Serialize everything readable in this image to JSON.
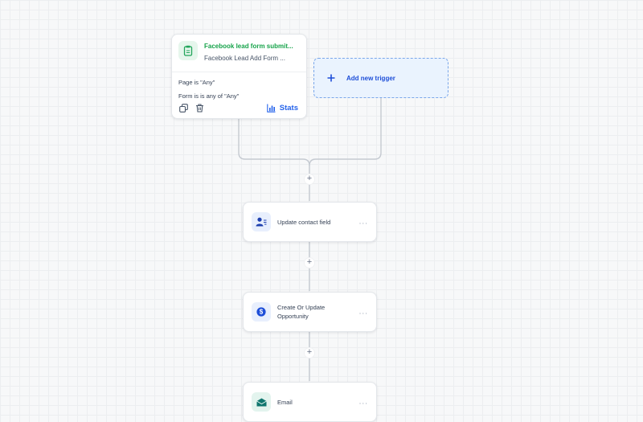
{
  "trigger": {
    "icon": "clipboard-icon",
    "title": "Facebook lead form submit...",
    "subtitle": "Facebook Lead Add Form ...",
    "filters": [
      "Page is \"Any\"",
      "Form is is any of \"Any\""
    ],
    "copy_icon": "copy-icon",
    "delete_icon": "trash-icon",
    "stats_label": "Stats"
  },
  "add_trigger": {
    "label": "Add new trigger",
    "icon": "plus-icon"
  },
  "add_step_symbol": "+",
  "actions": [
    {
      "icon": "contact-update-icon",
      "label": "Update contact field",
      "more": "..."
    },
    {
      "icon": "dollar-icon",
      "label": "Create Or Update Opportunity",
      "more": "..."
    },
    {
      "icon": "email-icon",
      "label": "Email",
      "more": "..."
    }
  ],
  "colors": {
    "accent": "#2563eb",
    "trigger_title": "#16a34a"
  }
}
